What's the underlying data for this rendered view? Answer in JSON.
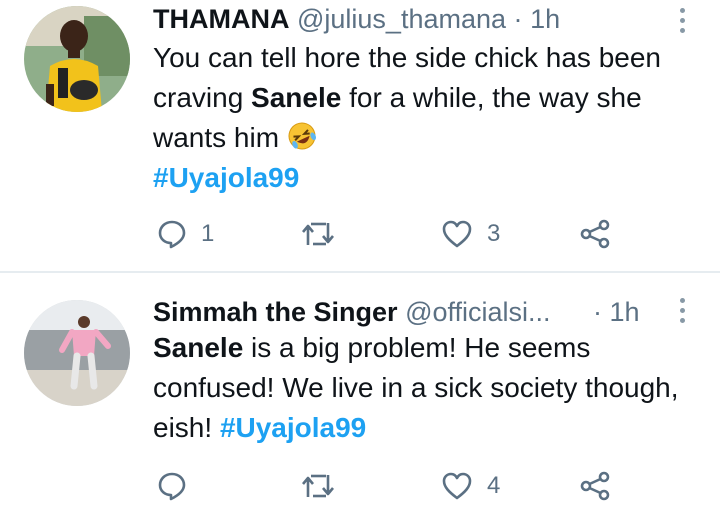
{
  "tweets": [
    {
      "display_name": "THAMANA",
      "handle": "@julius_thamana",
      "separator": "·",
      "time": "1h",
      "text_1": "You can tell hore the side chick has been craving ",
      "text_bold": "Sanele",
      "text_2": " for a while, the way she wants him ",
      "emoji": "rolling-on-floor-laughing-emoji",
      "hashtag": "#Uyajola99",
      "replies": "1",
      "retweets": "",
      "likes": "3"
    },
    {
      "display_name": "Simmah the Singer",
      "handle": "@officialsi...",
      "separator": "·",
      "time": "1h",
      "text_bold": "Sanele",
      "text_1": " is a big problem! He seems confused! We live in a sick society though, eish! ",
      "hashtag": "#Uyajola99",
      "replies": "",
      "retweets": "",
      "likes": "4"
    }
  ],
  "colors": {
    "text": "#0f1419",
    "secondary": "#5b7083",
    "hashtag": "#1da1f2",
    "divider": "#e6ecf0"
  }
}
